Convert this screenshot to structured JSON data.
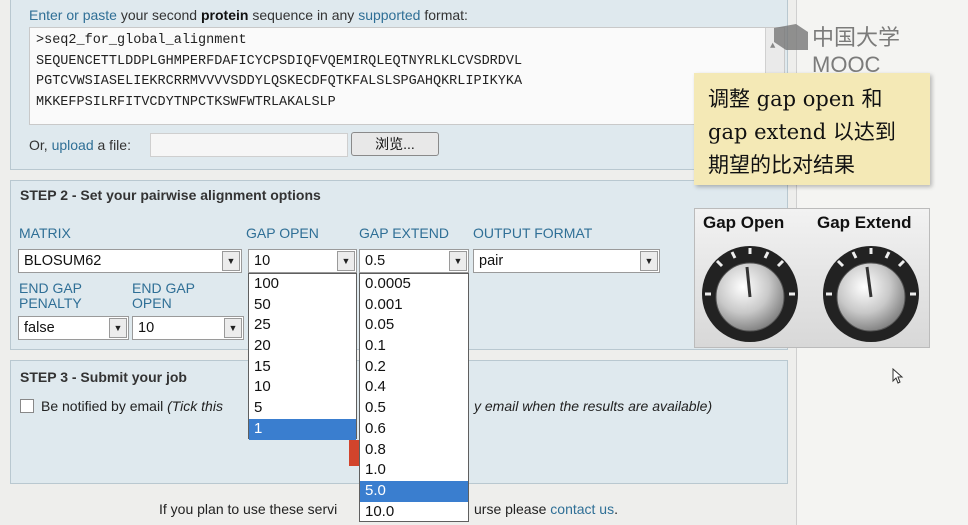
{
  "step1": {
    "prompt_pre": "Enter or paste",
    "prompt_mid": "your second",
    "prompt_bold": "protein",
    "prompt_mid2": "sequence in any",
    "prompt_link": "supported",
    "prompt_end": "format:",
    "sequence_lines": [
      ">seq2_for_global_alignment",
      "SEQUENCETTLDDPLGHMPERFDAFICYCPSDIQFVQEMIRQLEQTNYRLKLCVSDRDVL",
      "PGTCVWSIASELIEKRCRRMVVVVSDDYLQSKECDFQTKFALSLSPGAHQKRLIPIKYKA",
      "MKKEFPSILRFITVCDYTNPCTKSWFWTRLAKALSLP"
    ],
    "upload_pre": "Or,",
    "upload_link": "upload",
    "upload_post": "a file:",
    "browse_label": "浏览..."
  },
  "step2": {
    "heading": "STEP 2 - Set your pairwise alignment options",
    "matrix_label": "MATRIX",
    "matrix_value": "BLOSUM62",
    "gap_open_label": "GAP OPEN",
    "gap_open_value": "10",
    "gap_extend_label": "GAP EXTEND",
    "gap_extend_value": "0.5",
    "output_format_label": "OUTPUT FORMAT",
    "output_format_value": "pair",
    "end_gap_penalty_label": "END GAP PENALTY",
    "end_gap_penalty_value": "false",
    "end_gap_open_label": "END GAP OPEN",
    "end_gap_open_value": "10",
    "gap_open_options": [
      "100",
      "50",
      "25",
      "20",
      "15",
      "10",
      "5",
      "1"
    ],
    "gap_open_highlighted": "1",
    "gap_extend_options": [
      "0.0005",
      "0.001",
      "0.05",
      "0.1",
      "0.2",
      "0.4",
      "0.5",
      "0.6",
      "0.8",
      "1.0",
      "5.0",
      "10.0"
    ],
    "gap_extend_highlighted": "5.0"
  },
  "step3": {
    "heading": "STEP 3 - Submit your job",
    "notify_label": "Be notified by email",
    "notify_hint_start": "(Tick this",
    "notify_hint_end": "y email when the results are available)"
  },
  "footer": {
    "text_start": "If you plan to use these servi",
    "text_end": "urse please",
    "link": "contact us",
    "period": "."
  },
  "overlay": {
    "note_lines": [
      "调整 gap open 和",
      "gap extend 以达到",
      "期望的比对结果"
    ],
    "knob_label_left": "Gap Open",
    "knob_label_right": "Gap Extend",
    "logo_text": "中国大学MOOC"
  },
  "colors": {
    "link": "#2f6f96",
    "section_bg": "#dfe9ee",
    "highlight": "#3a7ecf",
    "note_bg": "#f4e9b6"
  }
}
